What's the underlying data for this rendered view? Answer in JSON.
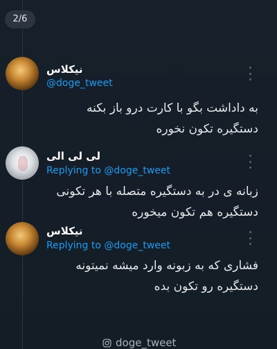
{
  "header": {
    "counter": "2/6"
  },
  "tweets": [
    {
      "name": "نیکلاس",
      "handle": "@doge_tweet",
      "replying": "",
      "text": "به داداشت بگو با کارت درو باز بکنه\nدستگیره تکون نخوره",
      "avatar": "gold-avatar"
    },
    {
      "name": "لی لی الی",
      "handle": "",
      "replying": "Replying to @doge_tweet",
      "text": "زبانه ی در به دستگیره متصله با هر تکونی\nدستگیره هم تکون میخوره",
      "avatar": "white-avatar"
    },
    {
      "name": "نیکلاس",
      "handle": "",
      "replying": "Replying to @doge_tweet",
      "text": "فشاری که به زبونه وارد میشه نمیتونه\nدستگیره رو تکون بده",
      "avatar": "gold-avatar"
    }
  ],
  "footer": {
    "text": "doge_tweet",
    "icon": "instagram-icon"
  },
  "colors": {
    "background": "#141d26",
    "link": "#1d9bf0",
    "text": "#e7e9ea"
  }
}
